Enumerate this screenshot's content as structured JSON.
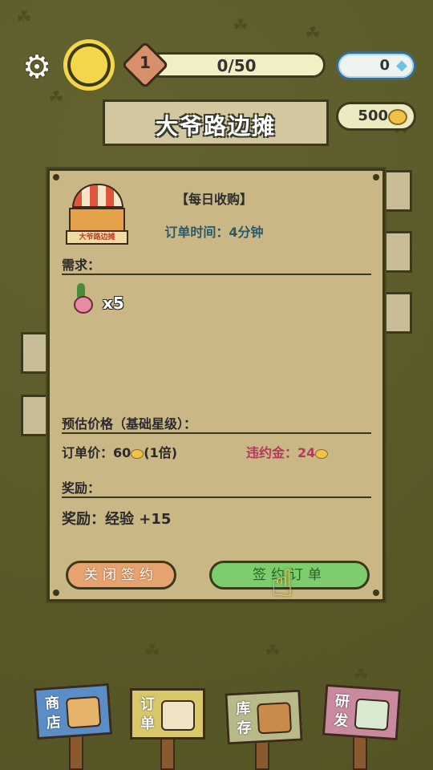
{
  "header": {
    "level": "1",
    "exp_progress": "0/50",
    "diamonds": "0",
    "coins": "500",
    "shop_name": "大爷路边摊"
  },
  "dialog": {
    "title": "【每日收购】",
    "order_time": "订单时间：4分钟",
    "stall_sign": "大爷路边摊",
    "demand_label": "需求：",
    "demand_qty": "x5",
    "estimate_label": "预估价格（基础星级）：",
    "order_price": "订单价：60",
    "order_price_suffix": "(1倍)",
    "penalty": "违约金：24",
    "reward_label": "奖励：",
    "reward_value": "奖励：经验 +15",
    "close_button": "关闭签约",
    "sign_button": "签约订单"
  },
  "nav": {
    "shop": "商店",
    "orders": "订单",
    "inventory": "库存",
    "research": "研发"
  },
  "colors": {
    "background": "#5b5a2a",
    "dialog": "#c9b886",
    "sign_button": "#7dcc6e",
    "close_button": "#e6a36f"
  }
}
